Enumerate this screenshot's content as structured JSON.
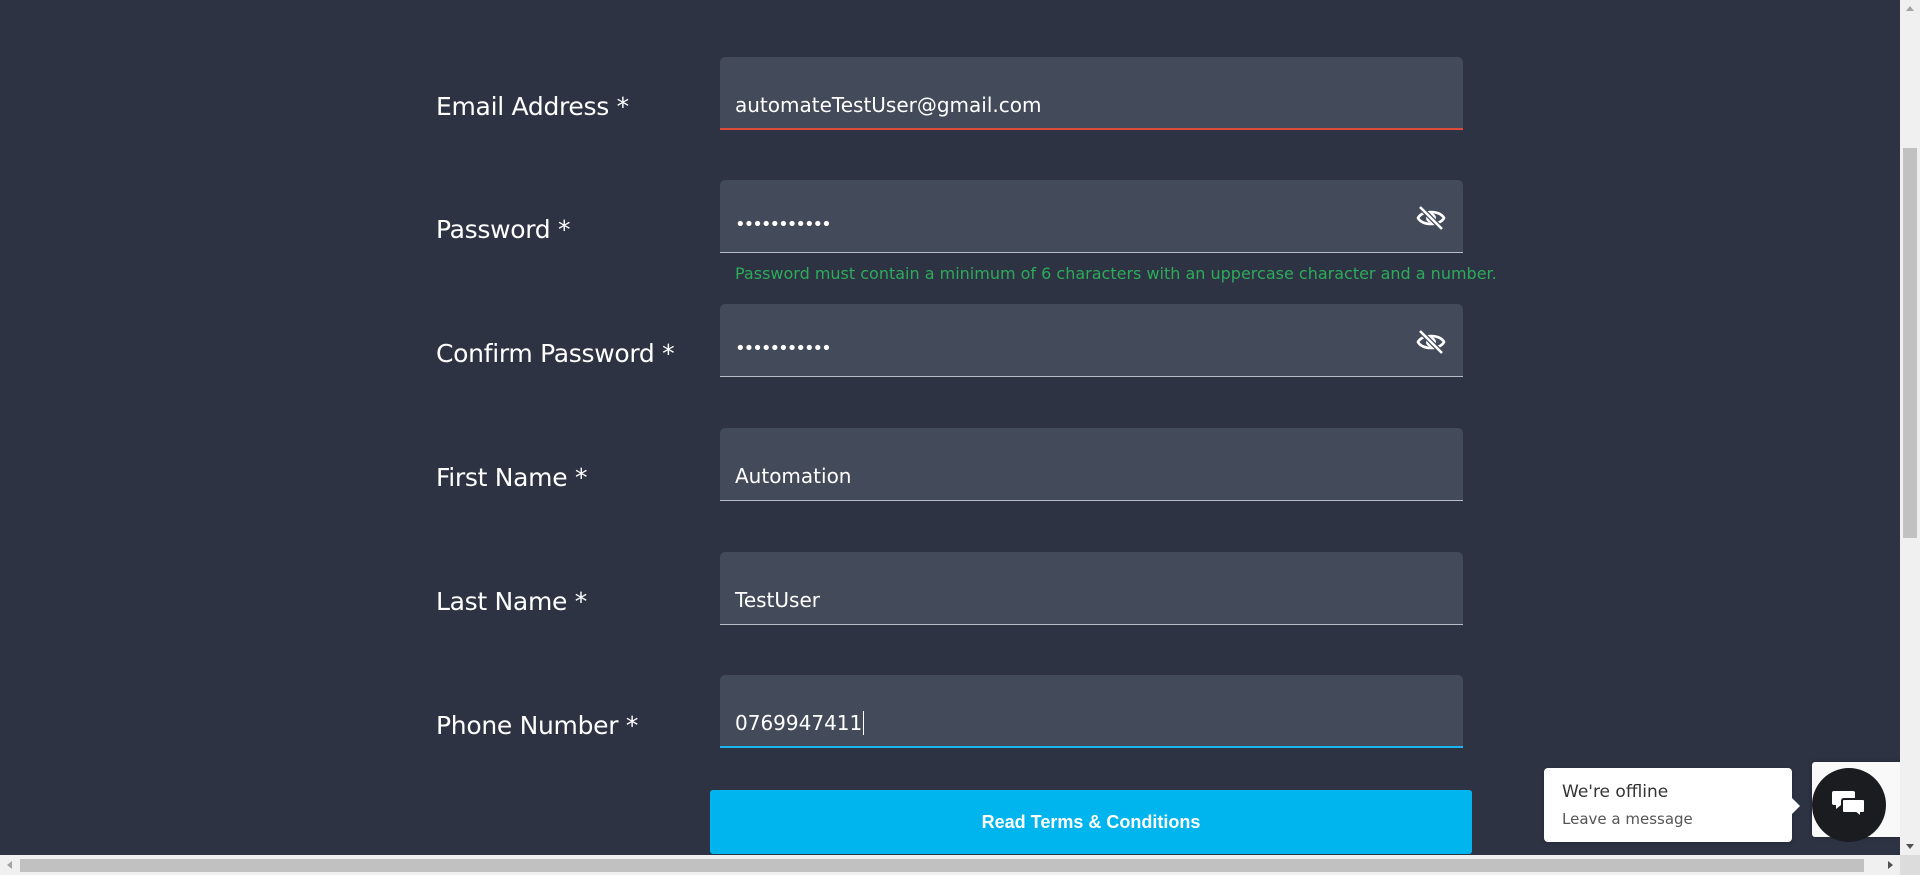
{
  "form": {
    "email": {
      "label": "Email Address *",
      "value": "automateTestUser@gmail.com"
    },
    "password": {
      "label": "Password *",
      "value": "•••••••••••",
      "hint": "Password must contain a minimum of 6 characters with an uppercase character and a number."
    },
    "confirm_password": {
      "label": "Confirm Password *",
      "value": "•••••••••••"
    },
    "first_name": {
      "label": "First Name *",
      "value": "Automation"
    },
    "last_name": {
      "label": "Last Name *",
      "value": "TestUser"
    },
    "phone": {
      "label": "Phone Number *",
      "value": "0769947411"
    },
    "terms_button": "Read Terms & Conditions"
  },
  "chat": {
    "title": "We're offline",
    "subtitle": "Leave a message"
  },
  "icons": {
    "password_toggle": "eye-off-icon",
    "chat": "chat-bubbles-icon"
  },
  "colors": {
    "background": "#2d3343",
    "field": "#434a59",
    "error_underline": "#e04a3a",
    "active_underline": "#1fb3ee",
    "hint": "#2cab5b",
    "button": "#00b5ee"
  }
}
